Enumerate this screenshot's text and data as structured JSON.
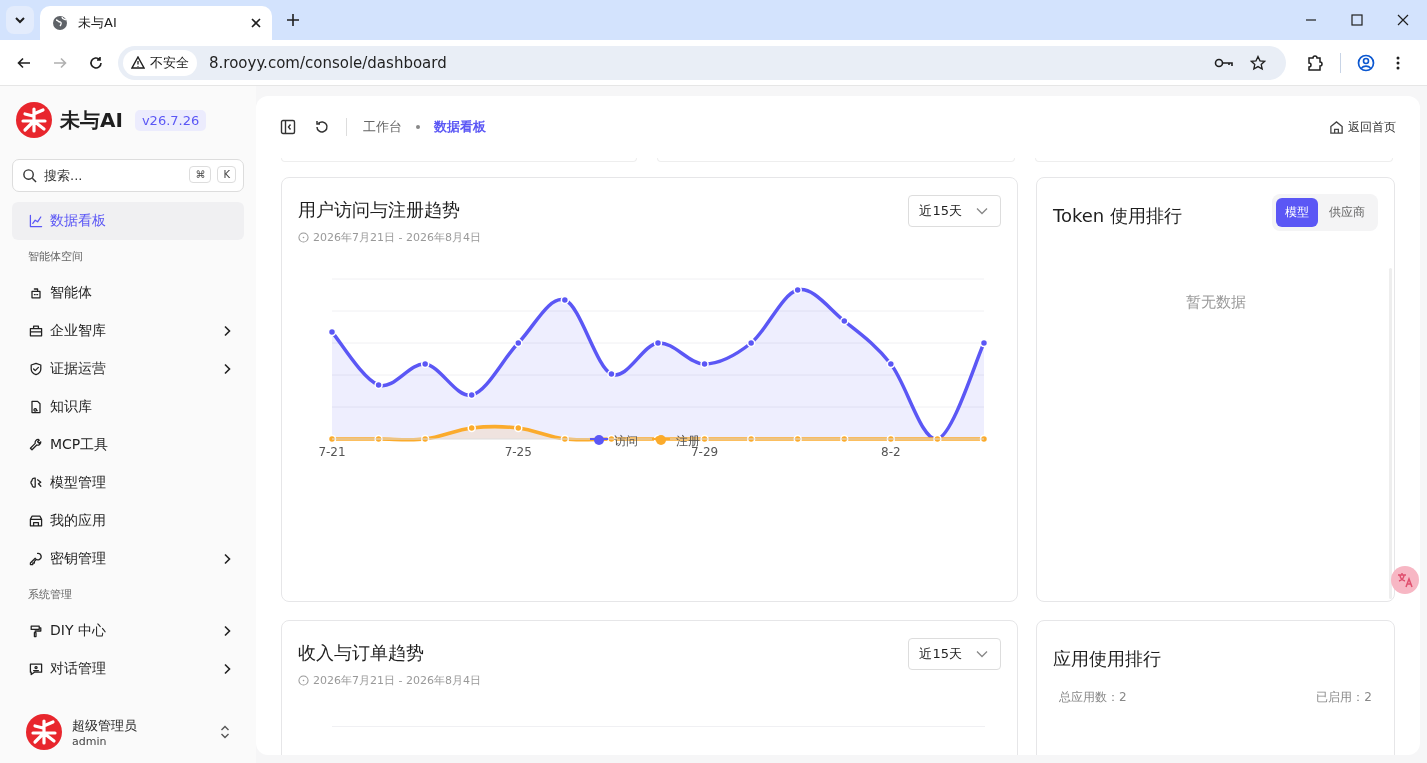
{
  "browser": {
    "tab_title": "未与AI",
    "security_label": "不安全",
    "url": "8.rooyy.com/console/dashboard"
  },
  "brand": {
    "name": "未与AI",
    "version": "v26.7.26"
  },
  "search": {
    "placeholder": "搜索...",
    "shortcut_keys": [
      "⌘",
      "K"
    ]
  },
  "sidebar": {
    "items": [
      {
        "kind": "item",
        "label": "数据看板",
        "selected": true,
        "expandable": false
      },
      {
        "kind": "section",
        "label": "智能体空间"
      },
      {
        "kind": "item",
        "label": "智能体",
        "selected": false,
        "expandable": false
      },
      {
        "kind": "item",
        "label": "企业智库",
        "selected": false,
        "expandable": true
      },
      {
        "kind": "item",
        "label": "证据运营",
        "selected": false,
        "expandable": true
      },
      {
        "kind": "item",
        "label": "知识库",
        "selected": false,
        "expandable": false
      },
      {
        "kind": "item",
        "label": "MCP工具",
        "selected": false,
        "expandable": false
      },
      {
        "kind": "item",
        "label": "模型管理",
        "selected": false,
        "expandable": false
      },
      {
        "kind": "item",
        "label": "我的应用",
        "selected": false,
        "expandable": false
      },
      {
        "kind": "item",
        "label": "密钥管理",
        "selected": false,
        "expandable": true
      },
      {
        "kind": "section",
        "label": "系统管理"
      },
      {
        "kind": "item",
        "label": "DIY 中心",
        "selected": false,
        "expandable": true
      },
      {
        "kind": "item",
        "label": "对话管理",
        "selected": false,
        "expandable": true
      }
    ]
  },
  "user": {
    "name": "超级管理员",
    "login": "admin"
  },
  "header": {
    "breadcrumb": [
      "工作台",
      "数据看板"
    ],
    "home_link": "返回首页"
  },
  "visits_card": {
    "title": "用户访问与注册趋势",
    "date_range": "2026年7月21日 - 2026年8月4日",
    "period": "近15天",
    "x_labels": [
      "7-21",
      "7-25",
      "7-29",
      "8-2"
    ],
    "legend": [
      {
        "name": "访问",
        "color": "#5b57f5"
      },
      {
        "name": "注册",
        "color": "#fbab2c"
      }
    ]
  },
  "token_card": {
    "title": "Token 使用排行",
    "toggle": [
      {
        "label": "模型",
        "selected": true
      },
      {
        "label": "供应商",
        "selected": false
      }
    ],
    "empty": "暂无数据"
  },
  "revenue_card": {
    "title": "收入与订单趋势",
    "date_range": "2026年7月21日 - 2026年8月4日",
    "period": "近15天"
  },
  "apps_card": {
    "title": "应用使用排行",
    "stats": [
      "总应用数：2",
      "已启用：2"
    ]
  }
}
